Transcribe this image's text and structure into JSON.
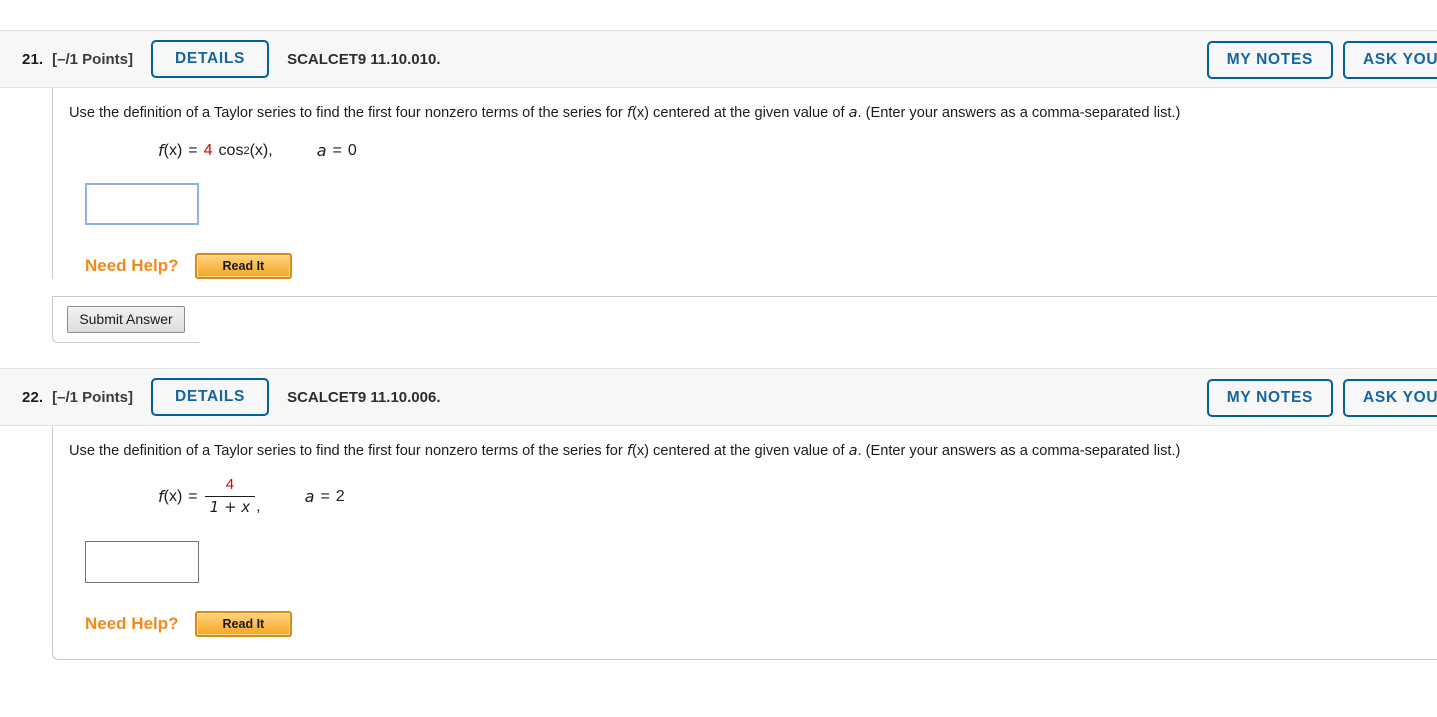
{
  "page": {
    "background": "#ffffff",
    "accent_blue": "#1565a0",
    "accent_orange": "#f08a1e",
    "math_red": "#e00000"
  },
  "questions": [
    {
      "number": "21.",
      "points": "[–/1 Points]",
      "details_label": "DETAILS",
      "code": "SCALCET9 11.10.010.",
      "my_notes_label": "MY NOTES",
      "ask_teacher_label": "ASK YOUR TEACHER",
      "prompt_part1": "Use the definition of a Taylor series to find the first four nonzero terms of the series for ",
      "prompt_fx": "f",
      "prompt_fx_paren": "(x)",
      "prompt_part2": " centered at the given value of ",
      "prompt_a": "a",
      "prompt_part3": ". (Enter your answers as a comma-separated list.)",
      "math": {
        "lhs": "f",
        "lhs_arg": "(x)",
        "equals": "=",
        "coefficient": "4",
        "func": "cos",
        "exponent": "2",
        "func_arg": "(x),",
        "avar": "a",
        "aequals": "=",
        "avalue": "0"
      },
      "answer_value": "",
      "answer_focused": true,
      "need_help_label": "Need Help?",
      "read_it_label": "Read It",
      "submit_label": "Submit Answer",
      "has_submit": true
    },
    {
      "number": "22.",
      "points": "[–/1 Points]",
      "details_label": "DETAILS",
      "code": "SCALCET9 11.10.006.",
      "my_notes_label": "MY NOTES",
      "ask_teacher_label": "ASK YOUR TEACHER",
      "prompt_part1": "Use the definition of a Taylor series to find the first four nonzero terms of the series for ",
      "prompt_fx": "f",
      "prompt_fx_paren": "(x)",
      "prompt_part2": " centered at the given value of ",
      "prompt_a": "a",
      "prompt_part3": ". (Enter your answers as a comma-separated list.)",
      "math": {
        "lhs": "f",
        "lhs_arg": "(x)",
        "equals": "=",
        "numerator": "4",
        "denominator": "1 + x",
        "comma": ",",
        "avar": "a",
        "aequals": "=",
        "avalue": "2"
      },
      "answer_value": "",
      "answer_focused": false,
      "need_help_label": "Need Help?",
      "read_it_label": "Read It",
      "submit_label": "Submit Answer",
      "has_submit": false
    }
  ]
}
